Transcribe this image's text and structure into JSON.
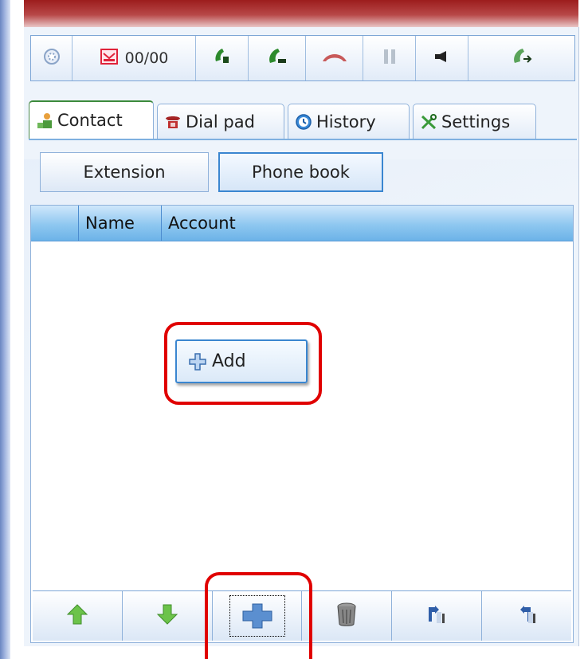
{
  "toolbar": {
    "counter": "00/00",
    "buttons": [
      "settings-gear-icon",
      "voicemail-icon",
      "call-speaker-icon",
      "call-mute-icon",
      "hangup-icon",
      "pause-icon",
      "speaker-icon",
      "call-transfer-icon"
    ]
  },
  "tabs": [
    {
      "label": "Contact",
      "active": true
    },
    {
      "label": "Dial pad",
      "active": false
    },
    {
      "label": "History",
      "active": false
    },
    {
      "label": "Settings",
      "active": false
    }
  ],
  "subtabs": {
    "extension": "Extension",
    "phonebook": "Phone book",
    "selected": "Phone book"
  },
  "list": {
    "columns": [
      "",
      "Name",
      "Account"
    ],
    "rows": []
  },
  "context_menu": {
    "add": "Add"
  },
  "bottom_bar": [
    "move-up-icon",
    "move-down-icon",
    "add-icon",
    "trash-icon",
    "import-icon",
    "export-icon"
  ],
  "colors": {
    "accent": "#3a86d0",
    "highlight": "#e00000",
    "title": "#9c1d1d"
  }
}
